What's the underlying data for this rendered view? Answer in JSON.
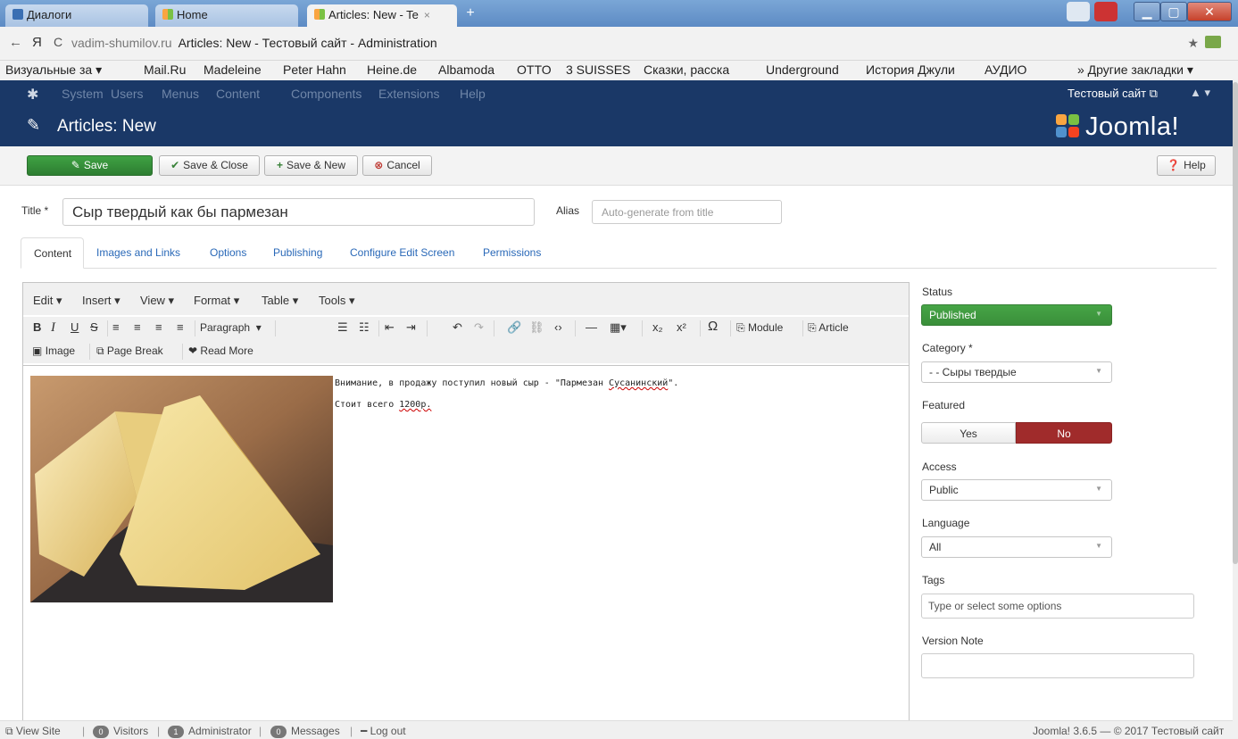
{
  "browser": {
    "tabs": [
      {
        "label": "Диалоги",
        "icon": "dialog-icon"
      },
      {
        "label": "Home",
        "icon": "joomla-icon"
      },
      {
        "label": "Articles: New - Te",
        "icon": "joomla-icon",
        "active": true
      }
    ],
    "new_tab": "+",
    "close_tab": "×",
    "back": "←",
    "yandex": "Я",
    "reload": "C",
    "url_domain": "vadim-shumilov.ru",
    "url_title": "Articles: New - Тестовый сайт - Administration",
    "star": "★",
    "bookmarks": [
      "Визуальные за ▾",
      "Mail.Ru",
      "Madeleine",
      "Peter Hahn",
      "Heine.de",
      "Albamoda",
      "OTTO",
      "3 SUISSES",
      "Сказки, расска",
      "Underground",
      "История Джули",
      "АУДИО"
    ],
    "other_bookmarks": "» Другие закладки ▾"
  },
  "admin_nav": {
    "menu": [
      "System",
      "Users",
      "Menus",
      "Content",
      "Components",
      "Extensions",
      "Help"
    ],
    "site_link": "Тестовый сайт ⧉"
  },
  "header": {
    "title": "Articles: New",
    "brand": "Joomla!"
  },
  "toolbar": {
    "save": "Save",
    "save_close": "Save & Close",
    "save_new": "Save & New",
    "cancel": "Cancel",
    "help": "Help"
  },
  "form": {
    "title_label": "Title *",
    "title_value": "Сыр твердый как бы пармезан",
    "alias_label": "Alias",
    "alias_placeholder": "Auto-generate from title"
  },
  "tabs": [
    "Content",
    "Images and Links",
    "Options",
    "Publishing",
    "Configure Edit Screen",
    "Permissions"
  ],
  "editor": {
    "menus": [
      "Edit ▾",
      "Insert ▾",
      "View ▾",
      "Format ▾",
      "Table ▾",
      "Tools ▾"
    ],
    "format_select": "Paragraph",
    "module_btn": "Module",
    "article_btn": "Article",
    "image_btn": "Image",
    "pagebreak_btn": "Page Break",
    "readmore_btn": "Read More",
    "line1_before": "Внимание, в продажу поступил новый сыр - \"Пармезан ",
    "line1_spell": "Сусанинский",
    "line1_after": "\".",
    "line2_before": "Стоит всего ",
    "line2_spell": "1200р."
  },
  "sidebar": {
    "status_label": "Status",
    "status_value": "Published",
    "category_label": "Category *",
    "category_value": "- - Сыры твердые",
    "featured_label": "Featured",
    "featured_yes": "Yes",
    "featured_no": "No",
    "access_label": "Access",
    "access_value": "Public",
    "language_label": "Language",
    "language_value": "All",
    "tags_label": "Tags",
    "tags_placeholder": "Type or select some options",
    "version_label": "Version Note"
  },
  "statusbar": {
    "view_site": "View Site",
    "visitors_count": "0",
    "visitors": "Visitors",
    "admin_count": "1",
    "admin": "Administrator",
    "messages_count": "0",
    "messages": "Messages",
    "logout": "Log out",
    "version": "Joomla! 3.6.5 — © 2017 Тестовый сайт"
  },
  "colors": {
    "admin_nav": "#1a3867",
    "save_green": "#2d7d31",
    "status_green": "#46a546",
    "featured_no": "#a02b2b",
    "link_blue": "#2a69b8"
  }
}
